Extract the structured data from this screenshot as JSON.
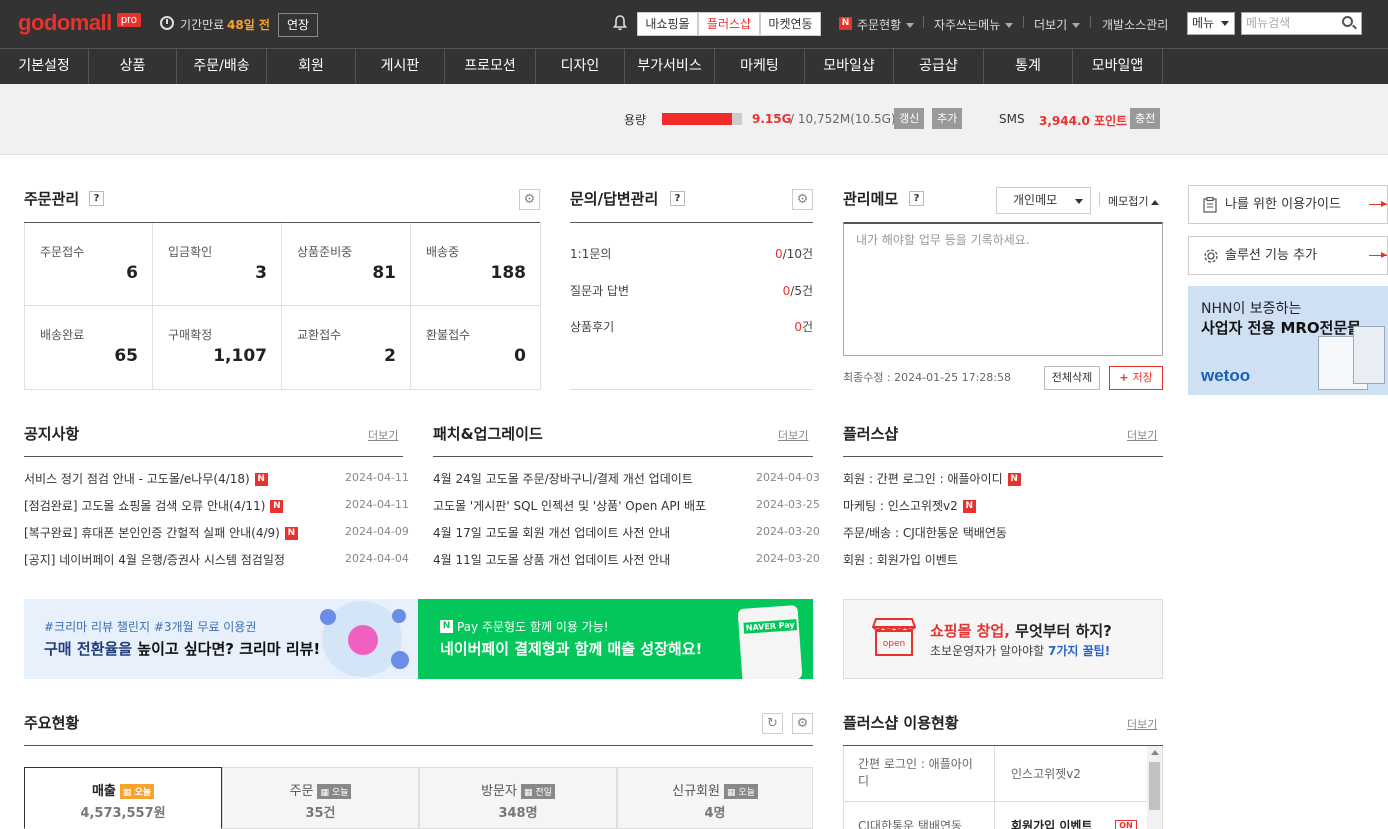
{
  "topbar": {
    "logo": "godomall",
    "logo_badge": "pro",
    "expire_label": "기간만료",
    "expire_days": "48일 전",
    "extend_label": "연장",
    "shop_tabs": [
      "내쇼핑몰",
      "플러스샵",
      "마켓연동"
    ],
    "order_status_label": "주문현황",
    "frequent_menu_label": "자주쓰는메뉴",
    "more_label": "더보기",
    "dev_source_label": "개발소스관리",
    "menu_select_value": "메뉴",
    "menu_search_placeholder": "메뉴검색"
  },
  "nav": {
    "items": [
      "기본설정",
      "상품",
      "주문/배송",
      "회원",
      "게시판",
      "프로모션",
      "디자인",
      "부가서비스",
      "마케팅",
      "모바일샵",
      "공급샵",
      "통계",
      "모바일앱"
    ]
  },
  "infobar": {
    "capacity_label": "용량",
    "capacity_used": "9.15G",
    "capacity_total": "/ 10,752M(10.5G)",
    "capacity_fraction": 0.87,
    "renew_label": "갱신",
    "add_label": "추가",
    "sms_label": "SMS",
    "sms_points": "3,944.0 포인트",
    "charge_label": "충전"
  },
  "order_mgmt": {
    "title": "주문관리",
    "help": "?",
    "cells": [
      {
        "label": "주문접수",
        "value": "6"
      },
      {
        "label": "입금확인",
        "value": "3"
      },
      {
        "label": "상품준비중",
        "value": "81"
      },
      {
        "label": "배송중",
        "value": "188"
      },
      {
        "label": "배송완료",
        "value": "65"
      },
      {
        "label": "구매확정",
        "value": "1,107"
      },
      {
        "label": "교환접수",
        "value": "2"
      },
      {
        "label": "환불접수",
        "value": "0"
      }
    ]
  },
  "qa_mgmt": {
    "title": "문의/답변관리",
    "help": "?",
    "rows": [
      {
        "label": "1:1문의",
        "count": "0",
        "suffix": "/10건"
      },
      {
        "label": "질문과 답변",
        "count": "0",
        "suffix": "/5건"
      },
      {
        "label": "상품후기",
        "count": "0",
        "suffix": "건"
      }
    ]
  },
  "memo": {
    "title": "관리메모",
    "help": "?",
    "type_value": "개인메모",
    "collapse_label": "메모접기",
    "placeholder": "내가 해야할 업무 등을 기록하세요.",
    "last_modified": "최종수정 : 2024-01-25 17:28:58",
    "delete_all_label": "전체삭제",
    "save_label": "저장"
  },
  "sidebar": {
    "guide_label": "나를 위한 이용가이드",
    "solution_label": "솔루션 기능 추가",
    "ad_line1": "NHN이 보증하는",
    "ad_line2": "사업자 전용 MRO전문몰",
    "ad_brand": "wetoo"
  },
  "notice": {
    "title": "공지사항",
    "more": "더보기",
    "items": [
      {
        "text": "서비스 정기 점검 안내 - 고도몰/e나무(4/18)",
        "date": "2024-04-11",
        "new": "N"
      },
      {
        "text": "[점검완료] 고도몰 쇼핑몰 검색 오류 안내(4/11)",
        "date": "2024-04-11",
        "new": "N"
      },
      {
        "text": "[복구완료] 휴대폰 본인인증 간헐적 실패 안내(4/9)",
        "date": "2024-04-09",
        "new": "N"
      },
      {
        "text": "[공지] 네이버페이 4월 은행/증권사 시스템 점검일정",
        "date": "2024-04-04",
        "new": ""
      }
    ]
  },
  "patch": {
    "title": "패치&업그레이드",
    "more": "더보기",
    "items": [
      {
        "text": "4월 24일 고도몰 주문/장바구니/결제 개선 업데이트",
        "date": "2024-04-03"
      },
      {
        "text": "고도몰 '게시판' SQL 인젝션 및 '상품' Open API 배포",
        "date": "2024-03-25"
      },
      {
        "text": "4월 17일 고도몰 회원 개선 업데이트 사전 안내",
        "date": "2024-03-20"
      },
      {
        "text": "4월 11일 고도몰 상품 개선 업데이트 사전 안내",
        "date": "2024-03-20"
      }
    ]
  },
  "plusshop": {
    "title": "플러스샵",
    "more": "더보기",
    "items": [
      {
        "text": "회원 : 간편 로그인 : 애플아이디",
        "new": "N"
      },
      {
        "text": "마케팅 : 인스고위젯v2",
        "new": "N"
      },
      {
        "text": "주문/배송 : CJ대한통운 택배연동",
        "new": ""
      },
      {
        "text": "회원 : 회원가입 이벤트",
        "new": ""
      }
    ]
  },
  "banners": {
    "crema_sub": "#크리마 리뷰 챌린지 #3개월 무료 이용권",
    "crema_main_a": "구매 전환율을 ",
    "crema_main_b": "높",
    "crema_main_c": "이고 싶다면? 크리마 리뷰!",
    "npay_n": "N",
    "npay_sub": "Pay 주문형도 함께 이용 가능!",
    "npay_main": "네이버페이 결제형과 함께 매출 성장해요!",
    "npay_card": "NAVER Pay",
    "startup_icon": "open",
    "startup_main_a": "쇼핑몰 창업,",
    "startup_main_b": " 무엇부터 하지?",
    "startup_sub_a": "초보운영자가 알아야할 ",
    "startup_sub_b": "7가지 꿀팁!"
  },
  "stats": {
    "title": "주요현황",
    "tabs": [
      {
        "label": "매출",
        "badge": "오늘",
        "value": "4,573,557원"
      },
      {
        "label": "주문",
        "badge": "오늘",
        "value": "35건"
      },
      {
        "label": "방문자",
        "badge": "전일",
        "value": "348명"
      },
      {
        "label": "신규회원",
        "badge": "오늘",
        "value": "4명"
      }
    ]
  },
  "plus_usage": {
    "title": "플러스샵 이용현황",
    "more": "더보기",
    "cells": [
      "간편 로그인 : 애플아이디",
      "인스고위젯v2",
      "CJ대한통운 택배연동",
      "회원가입 이벤트"
    ],
    "on_badge": "ON"
  },
  "colors": {
    "accent": "#e8322e",
    "dark": "#333333",
    "orange": "#f7a330",
    "npay_green": "#03c75a",
    "crema_bg": "#e8f1fb"
  }
}
